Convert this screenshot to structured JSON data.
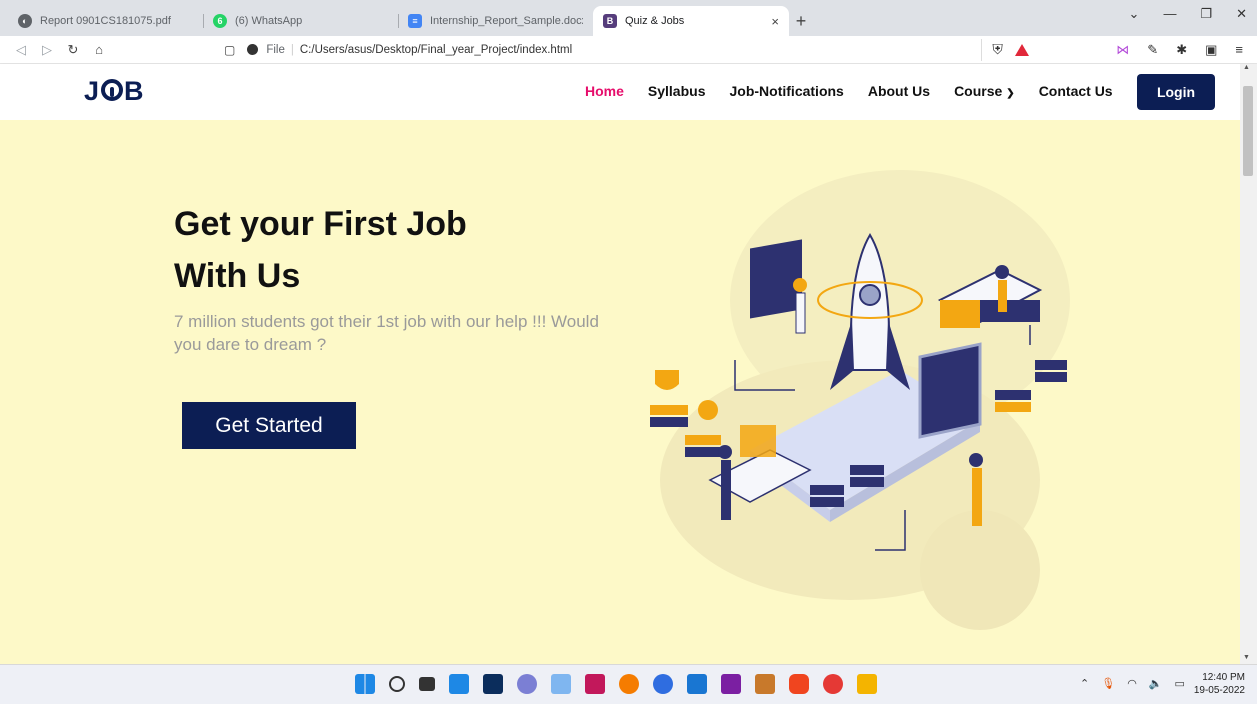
{
  "browser": {
    "tabs": [
      {
        "title": "Report 0901CS181075.pdf",
        "icon": "globe-icon",
        "color": "#5f6368",
        "active": false
      },
      {
        "title": "(6) WhatsApp",
        "icon": "whatsapp-icon",
        "color": "#25d366",
        "active": false
      },
      {
        "title": "Internship_Report_Sample.docx - Goo",
        "icon": "docs-icon",
        "color": "#4285f4",
        "active": false
      },
      {
        "title": "Quiz & Jobs",
        "icon": "bootstrap-icon",
        "color": "#563d7c",
        "active": true
      }
    ],
    "new_tab_label": "+",
    "close_label": "×",
    "address": {
      "protocol_label": "File",
      "url": "C:/Users/asus/Desktop/Final_year_Project/index.html"
    }
  },
  "site": {
    "logo": {
      "left": "J",
      "right": "B"
    },
    "nav": [
      {
        "label": "Home",
        "active": true
      },
      {
        "label": "Syllabus",
        "active": false
      },
      {
        "label": "Job-Notifications",
        "active": false
      },
      {
        "label": "About Us",
        "active": false
      },
      {
        "label": "Course",
        "active": false,
        "dropdown": true
      },
      {
        "label": "Contact Us",
        "active": false
      }
    ],
    "login_label": "Login",
    "hero": {
      "title_line1": "Get your First Job",
      "title_line2": "With Us",
      "subtitle": "7 million students got their 1st job with our help !!! Would you dare to dream ?",
      "cta_label": "Get Started"
    },
    "colors": {
      "brand": "#0c1e54",
      "accent": "#e60d6b",
      "hero_bg": "#fdf9c8"
    }
  },
  "taskbar": {
    "clock_time": "12:40 PM",
    "clock_date": "19-05-2022"
  }
}
